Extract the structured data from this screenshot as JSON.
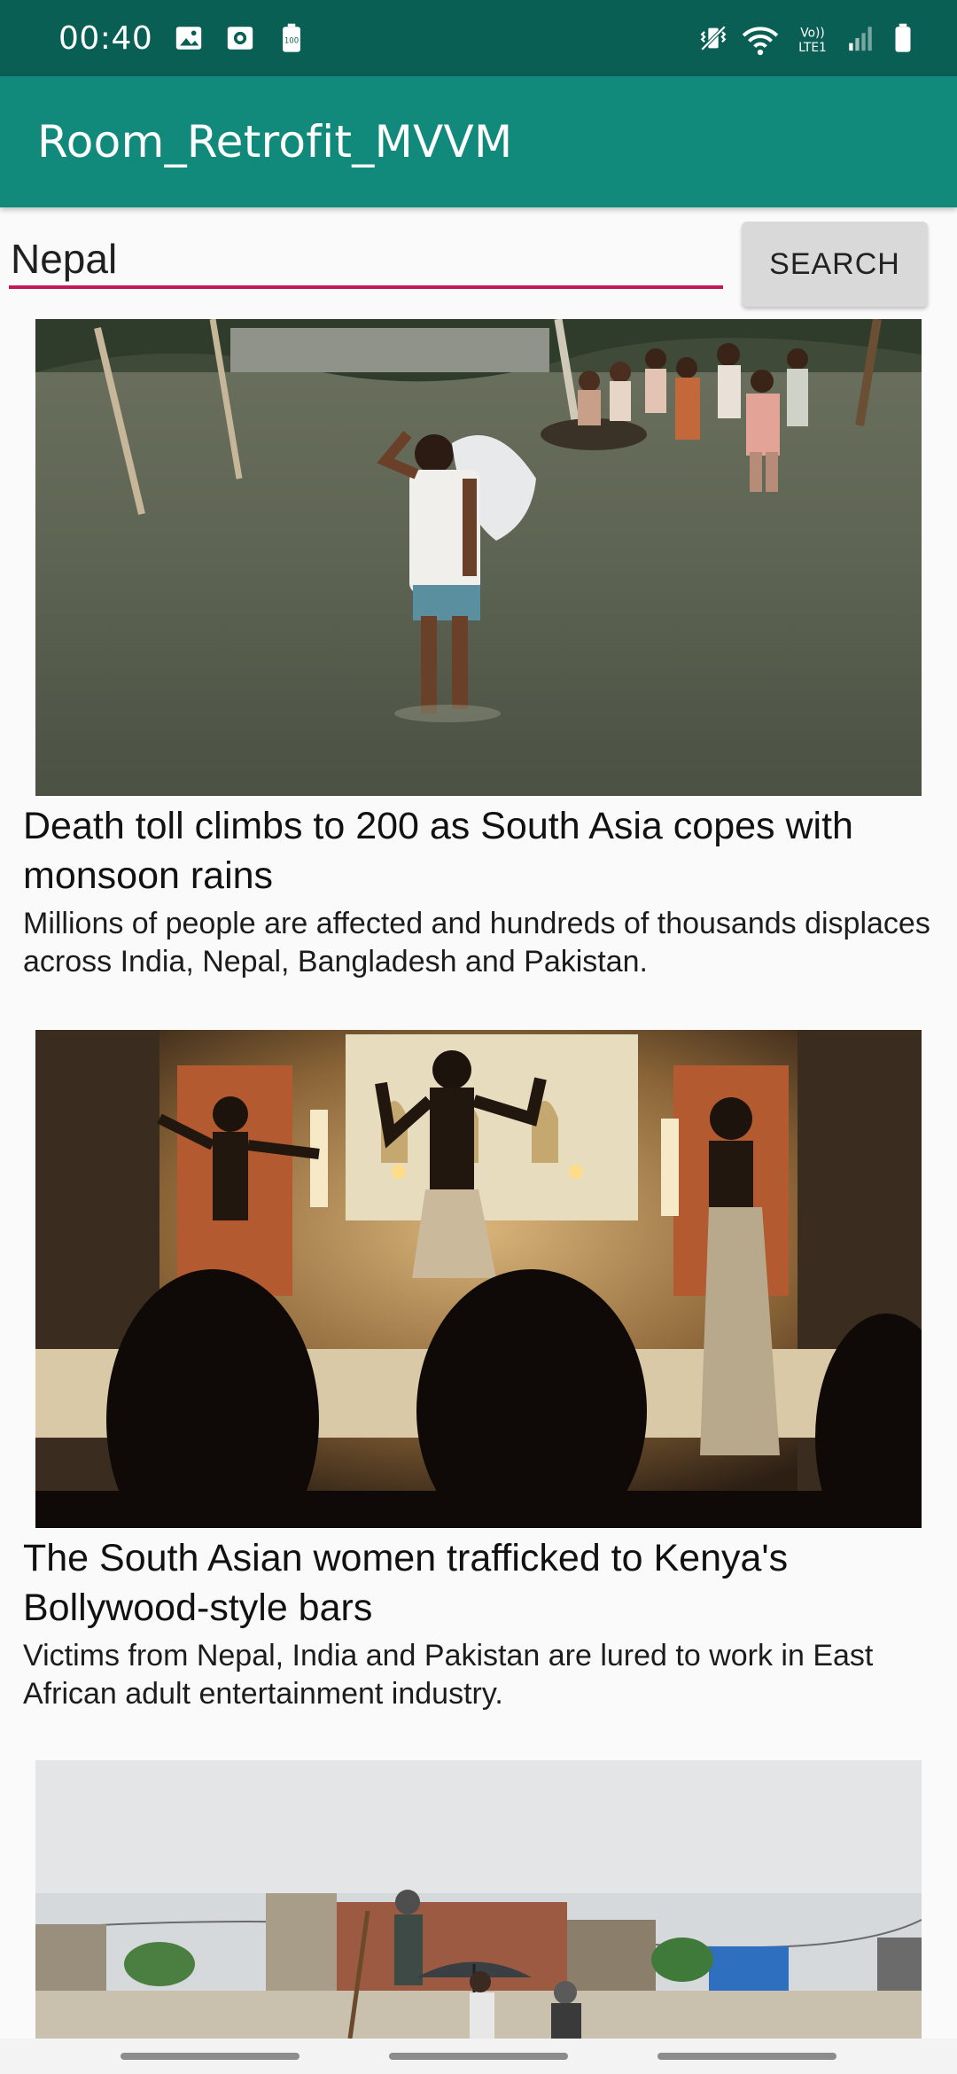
{
  "status_bar": {
    "time": "00:40",
    "left_icons": [
      "image-icon",
      "screen-record-icon",
      "battery-saver-100-icon"
    ],
    "right_icons": [
      "vibrate-icon",
      "wifi-icon",
      "volte-lte-icon",
      "signal-icon",
      "battery-icon"
    ],
    "volte_label": "Vo))",
    "lte_label": "LTE1",
    "battery_saver_label": "100"
  },
  "app_bar": {
    "title": "Room_Retrofit_MVVM",
    "color": "#11897b"
  },
  "search": {
    "value": "Nepal",
    "button_label": "SEARCH",
    "underline_color": "#c2185b"
  },
  "articles": [
    {
      "title": "Death toll climbs to 200 as South Asia copes with monsoon rains",
      "description": "Millions of people are affected and hundreds of thousands displaces across India, Nepal, Bangladesh and Pakistan.",
      "image": "flooded-village-photo"
    },
    {
      "title": "The South Asian women trafficked to Kenya's Bollywood-style bars",
      "description": "Victims from Nepal, India and Pakistan are lured to work in East African adult entertainment industry.",
      "image": "dancers-in-bar-photo"
    },
    {
      "title": "",
      "description": "",
      "image": "flooded-street-umbrella-photo"
    }
  ]
}
